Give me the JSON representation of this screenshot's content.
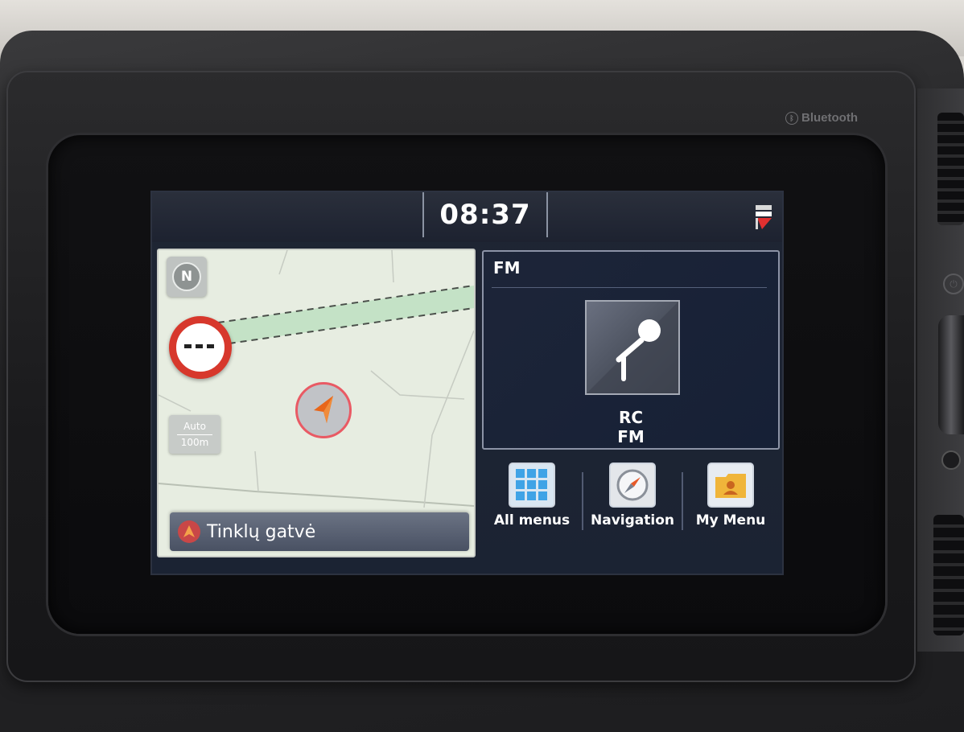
{
  "bezel": {
    "brand_label": "Bluetooth"
  },
  "status_bar": {
    "time": "08:37"
  },
  "map": {
    "compass_letter": "N",
    "zoom_mode": "Auto",
    "scale": "100m",
    "street_name": "Tinklų gatvė"
  },
  "radio": {
    "source_title": "FM",
    "station_name": "RC",
    "band": "FM"
  },
  "shortcuts": [
    {
      "label": "All menus",
      "icon": "grid-icon"
    },
    {
      "label": "Navigation",
      "icon": "compass-icon"
    },
    {
      "label": "My Menu",
      "icon": "folder-person-icon"
    }
  ],
  "colors": {
    "screen_bg": "#1b2333",
    "map_bg": "#e7ede1",
    "sign_red": "#d7382c",
    "marker_orange": "#e8661a",
    "grid_blue": "#3fa3e6",
    "folder_yellow": "#f0b53a"
  }
}
